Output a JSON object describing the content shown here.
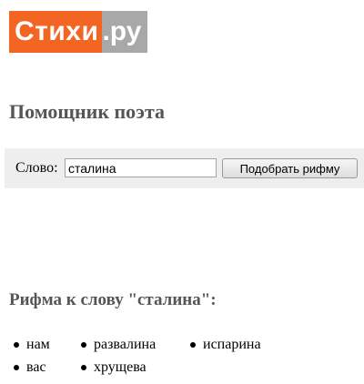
{
  "logo": {
    "main": "Стихи",
    "tld": ".ру",
    "colors": {
      "main_bg": "#f26522",
      "tld_bg": "#a8a8a8",
      "text": "#ffffff"
    }
  },
  "page_title": "Помощник поэта",
  "search": {
    "label": "Слово:",
    "value": "сталина",
    "button_label": "Подобрать рифму"
  },
  "results": {
    "heading": "Рифма к слову \"сталина\":",
    "columns": [
      [
        "нам",
        "вас"
      ],
      [
        "развалина",
        "хрущева"
      ],
      [
        "испарина"
      ]
    ]
  },
  "colors": {
    "heading": "#555555",
    "search_bar_bg": "#eeeeee"
  }
}
